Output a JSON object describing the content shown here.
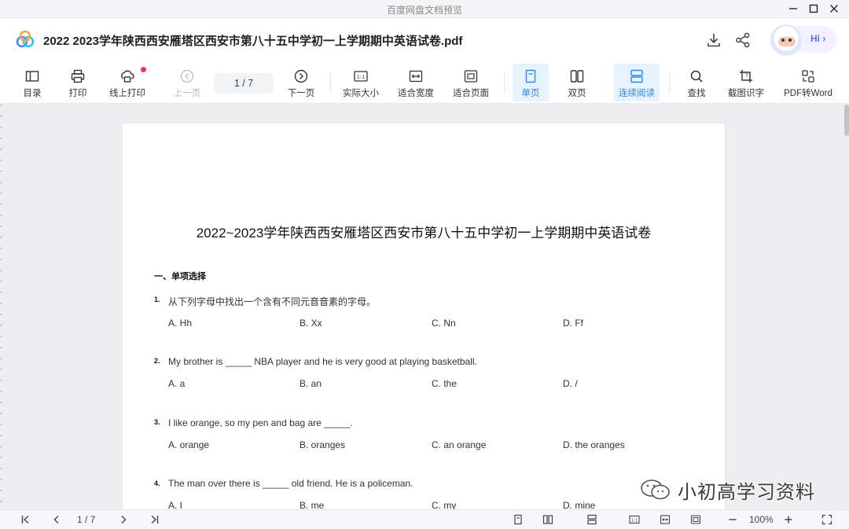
{
  "window": {
    "title": "百度网盘文档预览"
  },
  "header": {
    "file_title": "2022  2023学年陕西西安雁塔区西安市第八十五中学初一上学期期中英语试卷.pdf",
    "hi": "Hi ›"
  },
  "toolbar": {
    "toc": "目录",
    "print": "打印",
    "online_print": "线上打印",
    "prev_page": "上一页",
    "page_indicator": "1  / 7",
    "next_page": "下一页",
    "actual_size": "实际大小",
    "fit_width": "适合宽度",
    "fit_page": "适合页面",
    "single_page": "单页",
    "double_page": "双页",
    "continuous": "连续阅读",
    "find": "查找",
    "ocr": "截图识字",
    "pdf_to_word": "PDF转Word"
  },
  "colors": {
    "accent": "#2b8ae8",
    "active_bg": "#e6f2fd",
    "badge": "#f0384b"
  },
  "document": {
    "title": "2022~2023学年陕西西安雁塔区西安市第八十五中学初一上学期期中英语试卷",
    "section": "一、单项选择",
    "questions": [
      {
        "num": "1.",
        "text": "从下列字母中找出一个含有不同元音音素的字母。",
        "options": [
          "A. Hh",
          "B. Xx",
          "C. Nn",
          "D. Ff"
        ]
      },
      {
        "num": "2.",
        "text": "My brother is _____ NBA player and he is very good at playing basketball.",
        "options": [
          "A. a",
          "B. an",
          "C. the",
          "D. /"
        ]
      },
      {
        "num": "3.",
        "text": "I like orange, so my pen and bag are _____.",
        "options": [
          "A. orange",
          "B. oranges",
          "C. an orange",
          "D. the oranges"
        ]
      },
      {
        "num": "4.",
        "text": "The man over there is _____ old friend. He is a policeman.",
        "options": [
          "A. I",
          "B. me",
          "C. my",
          "D. mine"
        ]
      }
    ]
  },
  "watermark": {
    "text": "小初高学习资料"
  },
  "bottombar": {
    "page_indicator": "1  / 7",
    "zoom": "100%"
  }
}
